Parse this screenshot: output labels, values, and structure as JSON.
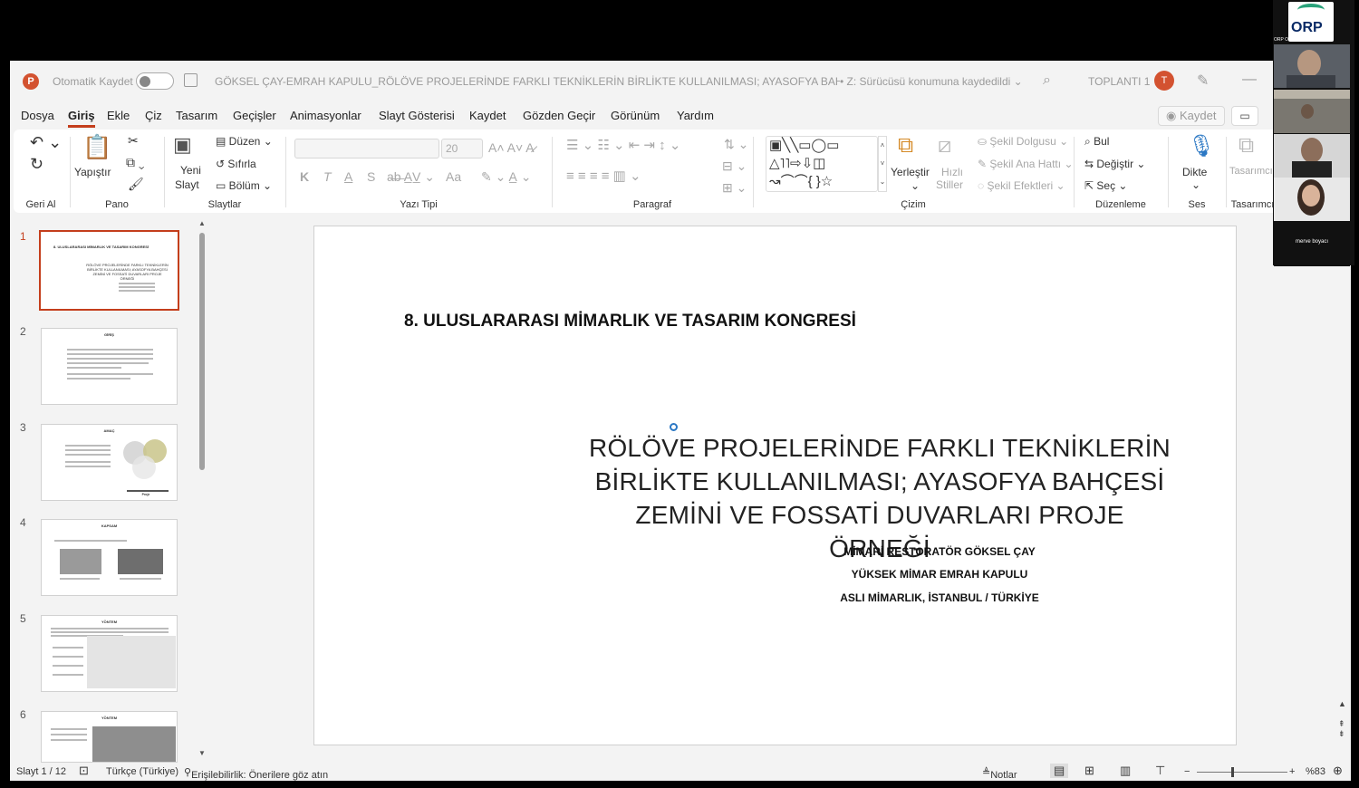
{
  "titlebar": {
    "autosave_label": "Otomatik Kaydet",
    "doc_title": "GÖKSEL ÇAY-EMRAH KAPULU_RÖLÖVE PROJELERİNDE FARKLI TEKNİKLERİN BİRLİKTE KULLANILMASI; AYASOFYA BAHÇESİ PROJE Ö...",
    "doc_location": "•  Z: Sürücüsü konumuna kaydedildi ⌄",
    "meeting": "TOPLANTI 1",
    "avatar_initial": "T"
  },
  "menu": {
    "items": [
      "Dosya",
      "Giriş",
      "Ekle",
      "Çiz",
      "Tasarım",
      "Geçişler",
      "Animasyonlar",
      "Slayt Gösterisi",
      "Kaydet",
      "Gözden Geçir",
      "Görünüm",
      "Yardım"
    ],
    "active": "Giriş",
    "record_label": "Kaydet"
  },
  "ribbon": {
    "undo_group": "Geri Al",
    "clipboard": {
      "paste": "Yapıştır",
      "label": "Pano"
    },
    "slides": {
      "new_slide_1": "Yeni",
      "new_slide_2": "Slayt",
      "layout": "Düzen",
      "reset": "Sıfırla",
      "section": "Bölüm",
      "label": "Slaytlar"
    },
    "font": {
      "size": "20",
      "bold": "K",
      "italic": "T",
      "underline": "A",
      "shadow": "S",
      "case": "Aa",
      "label": "Yazı Tipi"
    },
    "paragraph": {
      "label": "Paragraf"
    },
    "drawing": {
      "arrange": "Yerleştir",
      "quick_1": "Hızlı",
      "quick_2": "Stiller",
      "fill": "Şekil Dolgusu",
      "outline": "Şekil Ana Hattı",
      "effects": "Şekil Efektleri",
      "label": "Çizim"
    },
    "editing": {
      "find": "Bul",
      "replace": "Değiştir",
      "select": "Seç",
      "label": "Düzenleme"
    },
    "voice": {
      "dictate": "Dikte",
      "label": "Ses"
    },
    "designer": {
      "button": "Tasarımcı",
      "label": "Tasarımcı"
    }
  },
  "thumbnails": [
    {
      "num": "1",
      "title": "8. ULUSLARARASI MİMARLIK VE TASARIM KONGRESİ",
      "subtitle": "RÖLÖVE PROJELERİNDE FARKLI TEKNİKLERİN BİRLİKTE KULLANILMASI; AYASOFYA BAHÇESİ ZEMİNİ VE FOSSATİ DUVARLARI PROJE ÖRNEĞİ"
    },
    {
      "num": "2",
      "title": "GİRİŞ"
    },
    {
      "num": "3",
      "title": "AMAÇ",
      "caption": "Proje"
    },
    {
      "num": "4",
      "title": "KAPSAM"
    },
    {
      "num": "5",
      "title": "YÖNTEM"
    },
    {
      "num": "6",
      "title": "YÖNTEM"
    }
  ],
  "slide": {
    "congress": "8. ULUSLARARASI MİMARLIK VE TASARIM KONGRESİ",
    "title_line1": "RÖLÖVE PROJELERİNDE FARKLI TEKNİKLERİN",
    "title_line2": "BİRLİKTE KULLANILMASI; AYASOFYA BAHÇESİ",
    "title_line3": "ZEMİNİ VE FOSSATİ DUVARLARI PROJE ÖRNEĞİ",
    "author1": "MİMARİ RESTORATÖR GÖKSEL ÇAY",
    "author2": "YÜKSEK MİMAR EMRAH KAPULU",
    "affiliation": "ASLI MİMARLIK, İSTANBUL / TÜRKİYE"
  },
  "status": {
    "slide_count": "Slayt 1 / 12",
    "language": "Türkçe (Türkiye)",
    "accessibility": "Erişilebilirlik: Önerilere göz atın",
    "notes": "Notlar",
    "zoom": "%83"
  },
  "video": {
    "logo_text": "ORP",
    "logo_caption": "ORP Organizasyon",
    "participants": [
      "",
      "",
      "",
      "",
      "merve boyacı"
    ]
  }
}
